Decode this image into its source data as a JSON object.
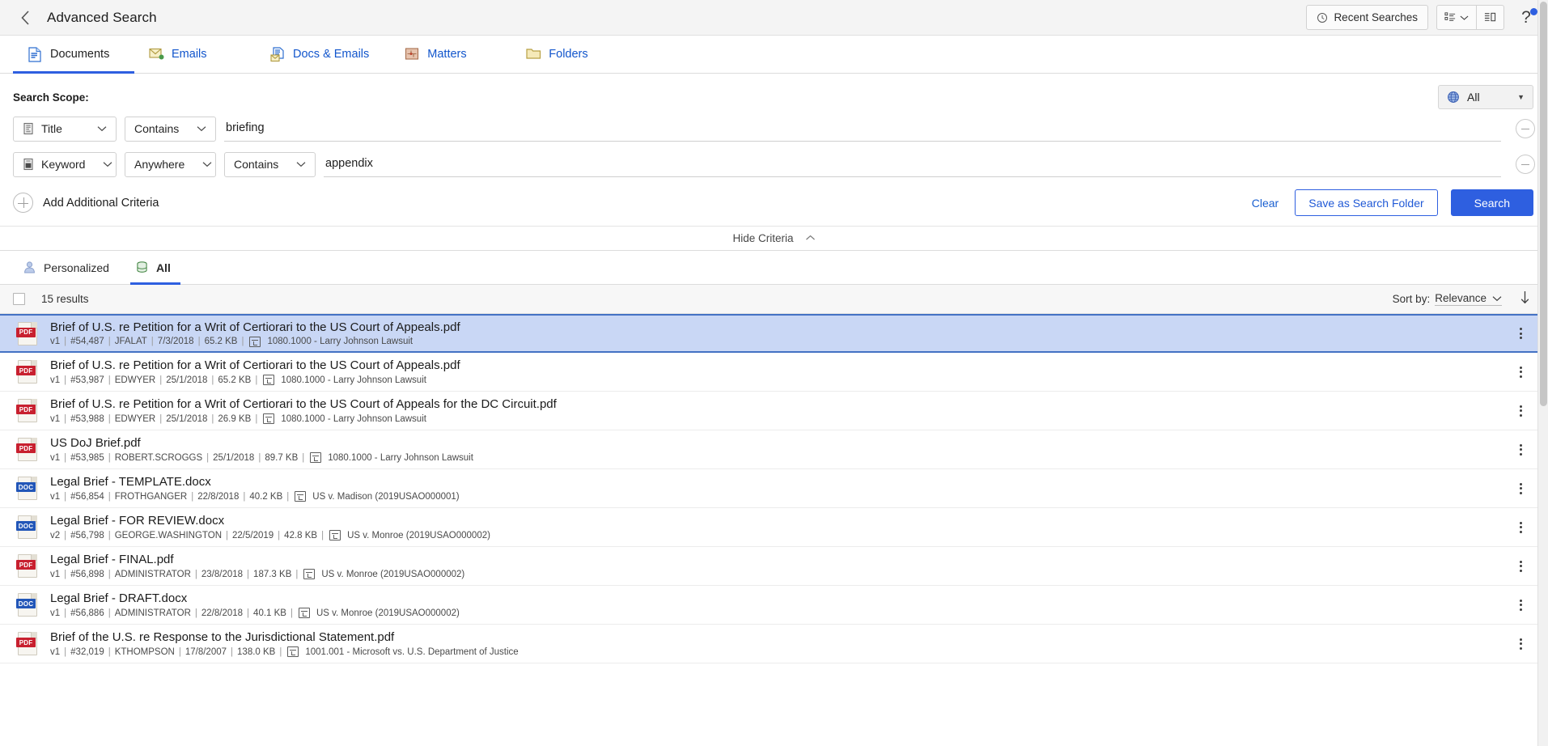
{
  "titlebar": {
    "back_icon": "chevron-left-icon",
    "title": "Advanced Search",
    "recent_searches": "Recent Searches",
    "recent_searches_icon": "history-clock-icon",
    "list_view_icon": "list-view-icon",
    "list_view_caret": "chevron-down-icon",
    "detail_view_icon": "detail-view-icon",
    "help_icon": "question-mark-icon"
  },
  "type_tabs": [
    {
      "label": "Documents",
      "icon": "document-icon",
      "active": true
    },
    {
      "label": "Emails",
      "icon": "email-icon",
      "active": false
    },
    {
      "label": "Docs & Emails",
      "icon": "docs-and-emails-icon",
      "active": false
    },
    {
      "label": "Matters",
      "icon": "matter-icon",
      "active": false
    },
    {
      "label": "Folders",
      "icon": "folder-icon",
      "active": false
    }
  ],
  "criteria": {
    "scope_label": "Search Scope:",
    "scope_select": {
      "label": "All",
      "icon": "globe-icon",
      "caret": "▼"
    },
    "rows": [
      {
        "field": {
          "label": "Title",
          "icon": "title-field-icon"
        },
        "operator": {
          "label": "Contains"
        },
        "operator2": null,
        "value": "briefing",
        "placeholder": "",
        "remove_icon": "minus-circle-icon"
      },
      {
        "field": {
          "label": "Keyword",
          "icon": "keyword-field-icon"
        },
        "operator": {
          "label": "Anywhere"
        },
        "operator2": {
          "label": "Contains"
        },
        "value": "appendix",
        "placeholder": "",
        "remove_icon": "minus-circle-icon"
      }
    ],
    "add_criteria": "Add Additional Criteria",
    "add_criteria_icon": "plus-circle-icon",
    "clear": "Clear",
    "save_as_search_folder": "Save as Search Folder",
    "search": "Search",
    "hide_criteria": "Hide Criteria",
    "hide_criteria_icon": "chevron-up-icon"
  },
  "result_tabs": [
    {
      "label": "Personalized",
      "icon": "person-icon",
      "active": false
    },
    {
      "label": "All",
      "icon": "database-icon",
      "active": true
    }
  ],
  "results_toolbar": {
    "select_all_checkbox": "select-all-checkbox",
    "count": "15 results",
    "sort_by_label": "Sort by:",
    "sort_by_value": "Relevance",
    "sort_caret": "chevron-down-icon",
    "sort_direction_icon": "arrow-down-icon"
  },
  "results": [
    {
      "type": "PDF",
      "title": "Brief of U.S. re Petition for a Writ of Certiorari to the US Court of Appeals.pdf",
      "version": "v1",
      "id": "#54,487",
      "author": "JFALAT",
      "date": "7/3/2018",
      "size": "65.2 KB",
      "matter": "1080.1000 - Larry Johnson Lawsuit",
      "selected": true
    },
    {
      "type": "PDF",
      "title": "Brief of U.S. re Petition for a Writ of Certiorari to the US Court of Appeals.pdf",
      "version": "v1",
      "id": "#53,987",
      "author": "EDWYER",
      "date": "25/1/2018",
      "size": "65.2 KB",
      "matter": "1080.1000 - Larry Johnson Lawsuit",
      "selected": false
    },
    {
      "type": "PDF",
      "title": "Brief of U.S. re Petition for a Writ of Certiorari to the US Court of Appeals for the DC Circuit.pdf",
      "version": "v1",
      "id": "#53,988",
      "author": "EDWYER",
      "date": "25/1/2018",
      "size": "26.9 KB",
      "matter": "1080.1000 - Larry Johnson Lawsuit",
      "selected": false
    },
    {
      "type": "PDF",
      "title": "US DoJ Brief.pdf",
      "version": "v1",
      "id": "#53,985",
      "author": "ROBERT.SCROGGS",
      "date": "25/1/2018",
      "size": "89.7 KB",
      "matter": "1080.1000 - Larry Johnson Lawsuit",
      "selected": false
    },
    {
      "type": "DOC",
      "title": "Legal Brief - TEMPLATE.docx",
      "version": "v1",
      "id": "#56,854",
      "author": "FROTHGANGER",
      "date": "22/8/2018",
      "size": "40.2 KB",
      "matter": "US v. Madison (2019USAO000001)",
      "selected": false
    },
    {
      "type": "DOC",
      "title": "Legal Brief - FOR REVIEW.docx",
      "version": "v2",
      "id": "#56,798",
      "author": "GEORGE.WASHINGTON",
      "date": "22/5/2019",
      "size": "42.8 KB",
      "matter": "US v. Monroe (2019USAO000002)",
      "selected": false
    },
    {
      "type": "PDF",
      "title": "Legal Brief - FINAL.pdf",
      "version": "v1",
      "id": "#56,898",
      "author": "ADMINISTRATOR",
      "date": "23/8/2018",
      "size": "187.3 KB",
      "matter": "US v. Monroe (2019USAO000002)",
      "selected": false
    },
    {
      "type": "DOC",
      "title": "Legal Brief - DRAFT.docx",
      "version": "v1",
      "id": "#56,886",
      "author": "ADMINISTRATOR",
      "date": "22/8/2018",
      "size": "40.1 KB",
      "matter": "US v. Monroe (2019USAO000002)",
      "selected": false
    },
    {
      "type": "PDF",
      "title": "Brief of the U.S. re Response to the Jurisdictional Statement.pdf",
      "version": "v1",
      "id": "#32,019",
      "author": "KTHOMPSON",
      "date": "17/8/2007",
      "size": "138.0 KB",
      "matter": "1001.001 - Microsoft vs. U.S. Department of Justice",
      "selected": false
    }
  ],
  "colors": {
    "accent": "#2e5fe0",
    "link": "#1155cc",
    "selected_row": "#c9d7f5",
    "selected_border": "#4472c4",
    "pdf_badge": "#c8202f",
    "doc_badge": "#2256b8"
  }
}
